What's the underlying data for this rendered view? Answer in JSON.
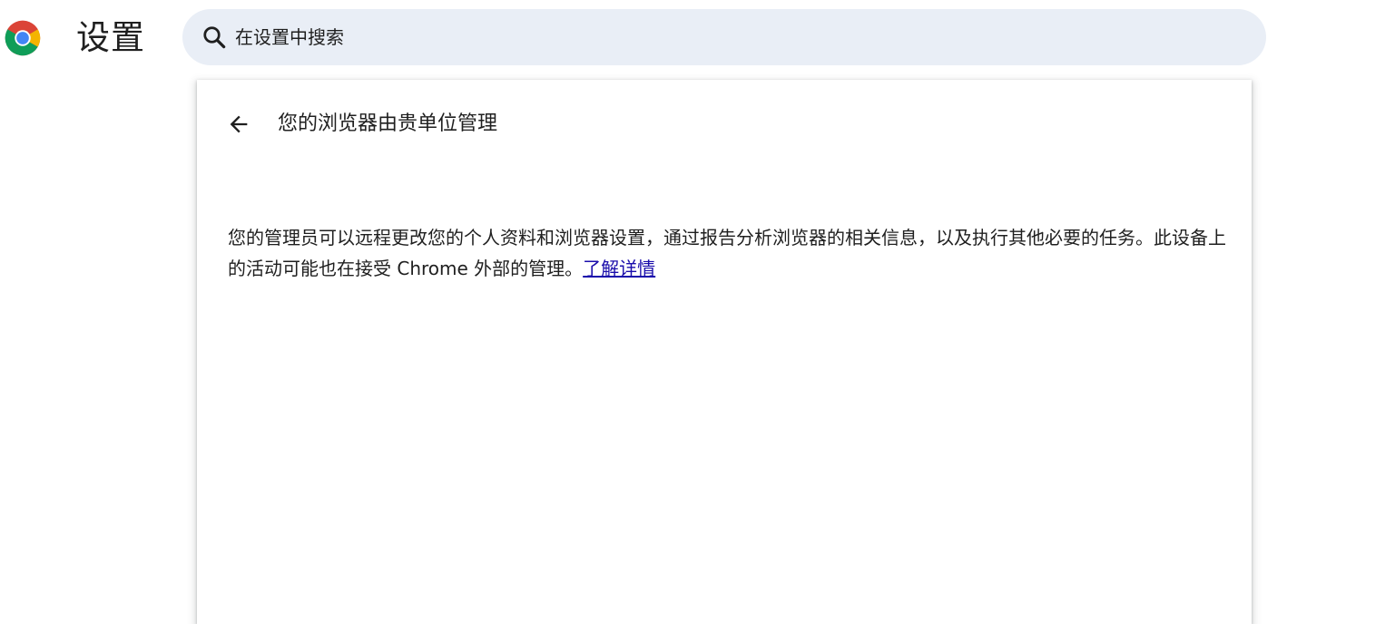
{
  "header": {
    "title": "设置",
    "logo_icon": "chrome-logo-icon"
  },
  "search": {
    "placeholder": "在设置中搜索",
    "icon": "search-icon"
  },
  "page": {
    "back_icon": "arrow-back-icon",
    "title": "您的浏览器由贵单位管理",
    "description": "您的管理员可以远程更改您的个人资料和浏览器设置，通过报告分析浏览器的相关信息，以及执行其他必要的任务。此设备上的活动可能也在接受 Chrome 外部的管理。",
    "learn_more_label": "了解详情"
  },
  "colors": {
    "search_bg": "#e9eef6",
    "link": "#1a0dab",
    "text": "#1f1f1f"
  }
}
